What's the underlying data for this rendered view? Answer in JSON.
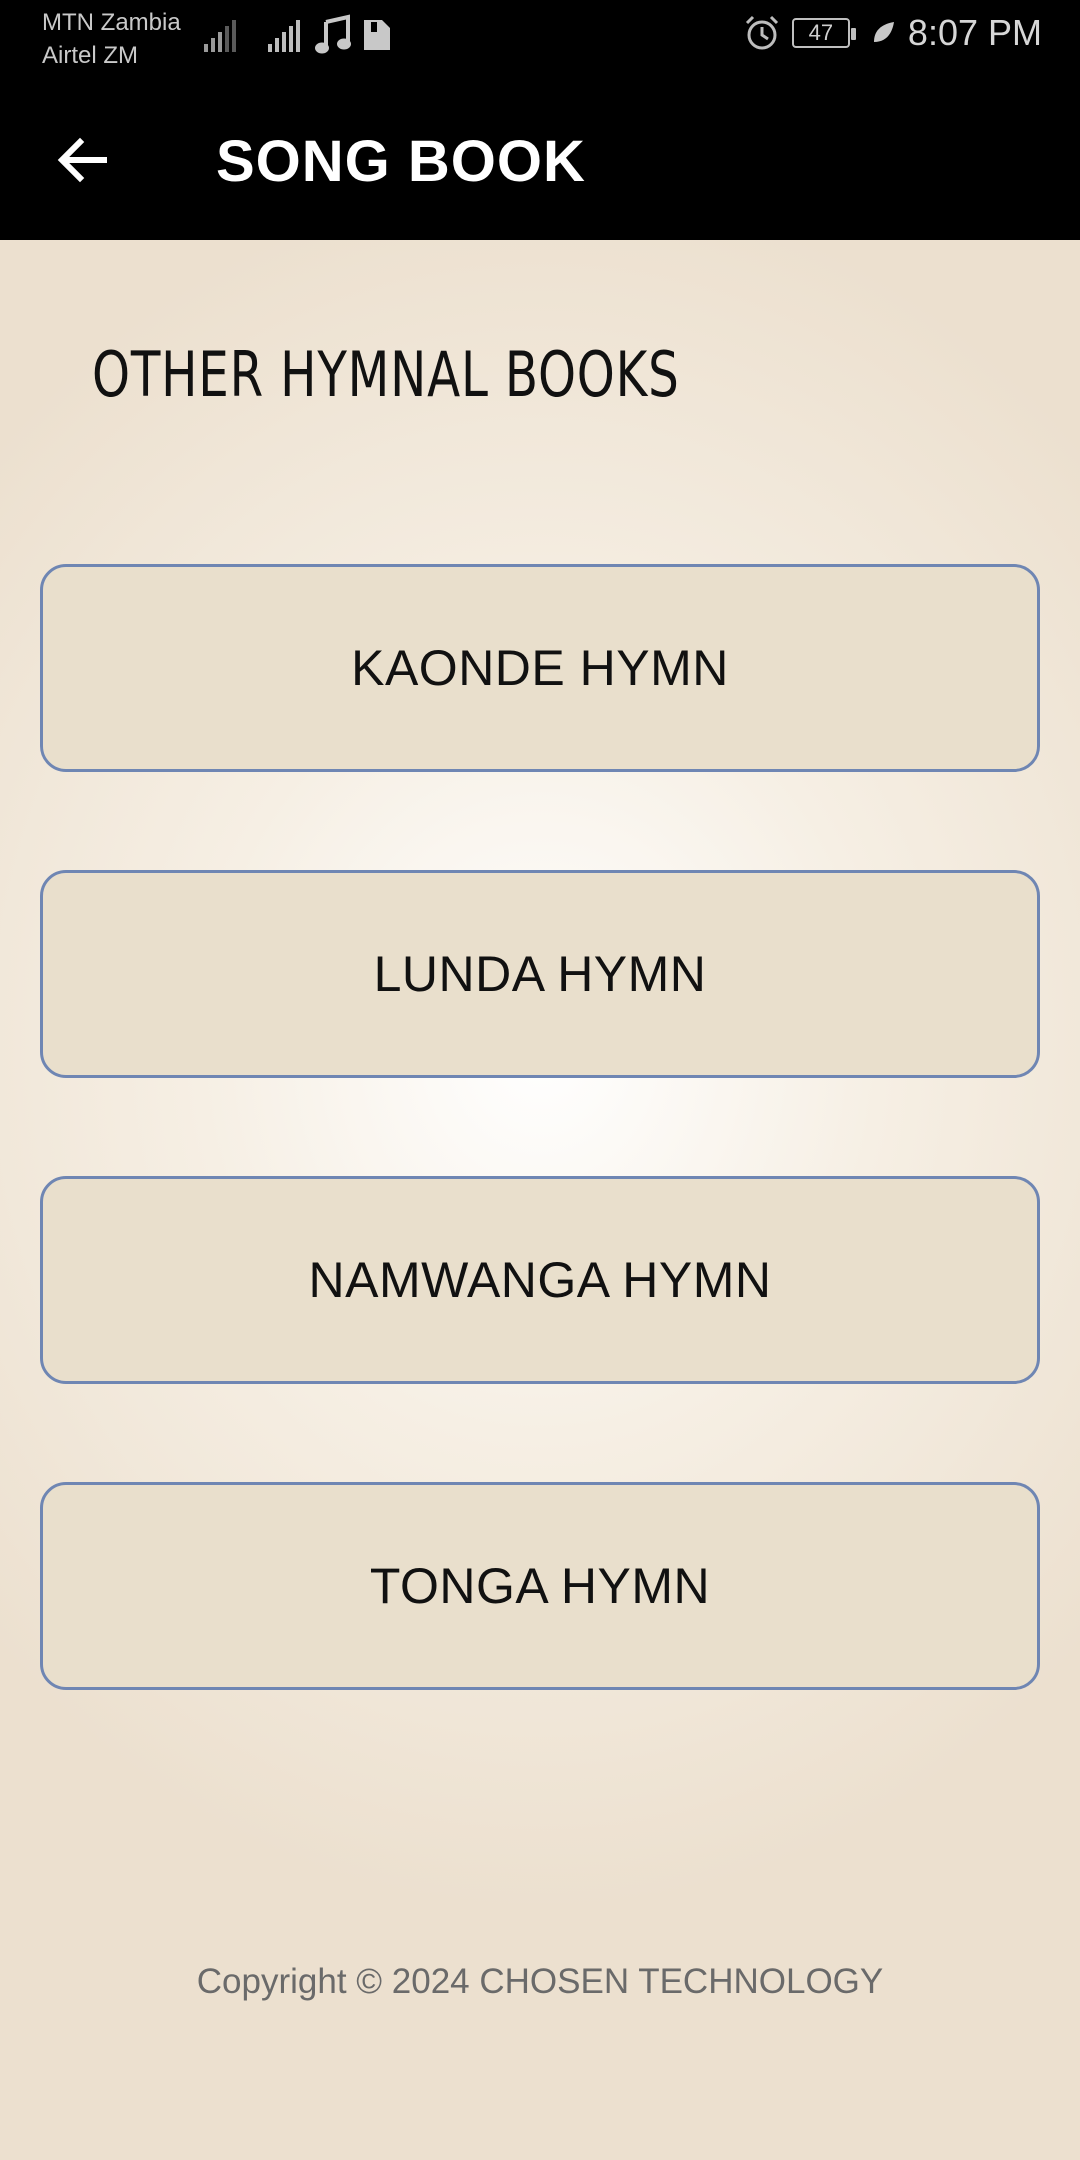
{
  "status_bar": {
    "carrier_1": "MTN Zambia",
    "carrier_2": "Airtel ZM",
    "battery": "47",
    "time": "8:07 PM",
    "icons": [
      "signal-icon",
      "signal-icon",
      "music-note-icon",
      "sim-card-icon",
      "alarm-icon",
      "battery-icon",
      "leaf-icon"
    ]
  },
  "app_bar": {
    "title": "SONG BOOK",
    "back_icon": "arrow-back-icon"
  },
  "main": {
    "section_title": "OTHER HYMNAL BOOKS",
    "buttons": [
      {
        "label": "KAONDE HYMN"
      },
      {
        "label": "LUNDA HYMN"
      },
      {
        "label": "NAMWANGA HYMN"
      },
      {
        "label": "TONGA HYMN"
      }
    ],
    "copyright": "Copyright © 2024 CHOSEN TECHNOLOGY"
  },
  "colors": {
    "app_bar_bg": "#000000",
    "button_fill": "#e9dfcc",
    "button_border": "#6f86b3",
    "background_light": "#ffffff",
    "background_edge": "#ece0cf"
  }
}
